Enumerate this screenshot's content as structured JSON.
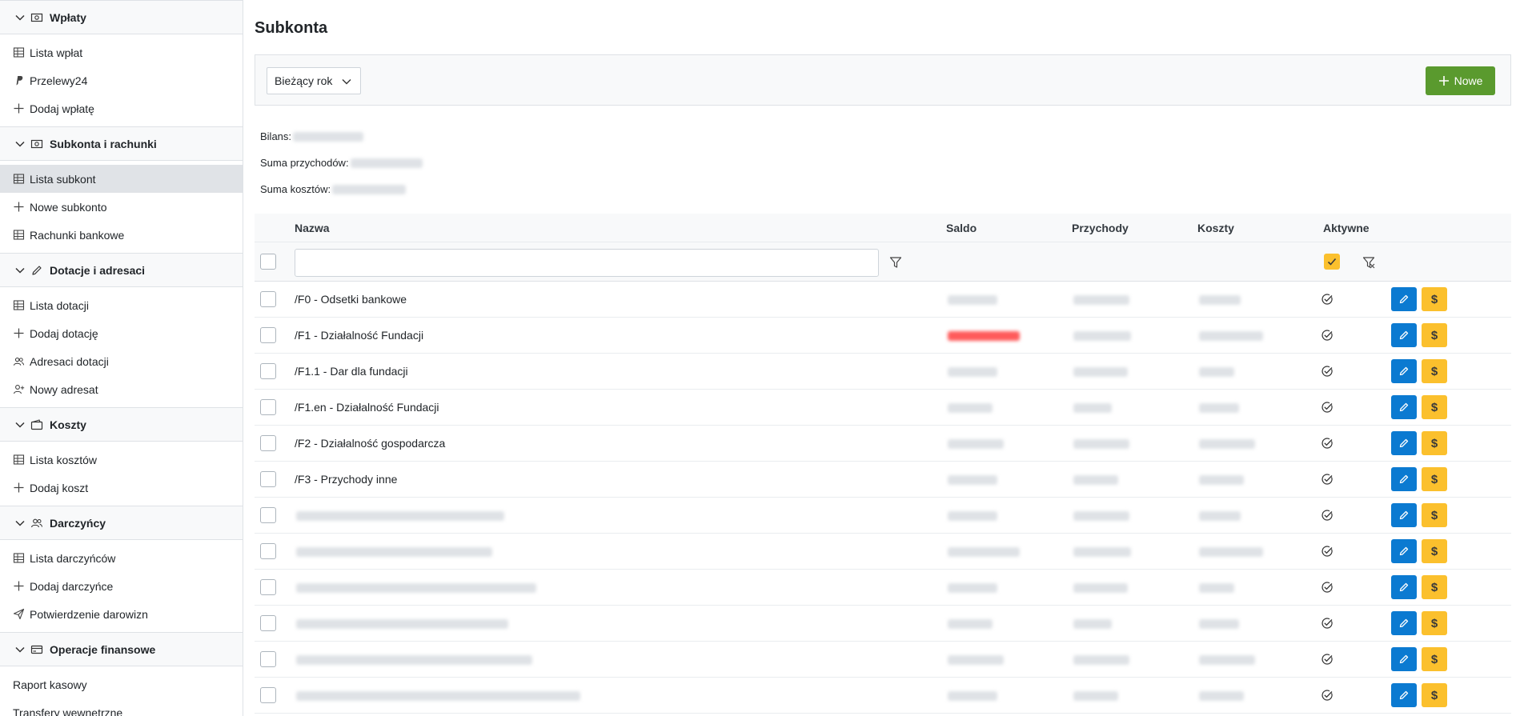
{
  "sidebar": {
    "sections": [
      {
        "title": "Wpłaty",
        "icon": "money-icon",
        "items": [
          {
            "label": "Lista wpłat",
            "icon": "table-icon"
          },
          {
            "label": "Przelewy24",
            "icon": "paypal-icon"
          },
          {
            "label": "Dodaj wpłatę",
            "icon": "plus-icon"
          }
        ]
      },
      {
        "title": "Subkonta i rachunki",
        "icon": "money-icon",
        "items": [
          {
            "label": "Lista subkont",
            "icon": "table-icon",
            "active": true
          },
          {
            "label": "Nowe subkonto",
            "icon": "plus-icon"
          },
          {
            "label": "Rachunki bankowe",
            "icon": "table-icon"
          }
        ]
      },
      {
        "title": "Dotacje i adresaci",
        "icon": "pencil-icon",
        "items": [
          {
            "label": "Lista dotacji",
            "icon": "table-icon"
          },
          {
            "label": "Dodaj dotację",
            "icon": "plus-icon"
          },
          {
            "label": "Adresaci dotacji",
            "icon": "users-icon"
          },
          {
            "label": "Nowy adresat",
            "icon": "user-plus-icon"
          }
        ]
      },
      {
        "title": "Koszty",
        "icon": "wallet-icon",
        "items": [
          {
            "label": "Lista kosztów",
            "icon": "table-icon"
          },
          {
            "label": "Dodaj koszt",
            "icon": "plus-icon"
          }
        ]
      },
      {
        "title": "Darczyńcy",
        "icon": "users-icon",
        "items": [
          {
            "label": "Lista darczyńców",
            "icon": "table-icon"
          },
          {
            "label": "Dodaj darczyńce",
            "icon": "plus-icon"
          },
          {
            "label": "Potwierdzenie darowizn",
            "icon": "send-icon"
          }
        ]
      },
      {
        "title": "Operacje finansowe",
        "icon": "card-icon",
        "items": [
          {
            "label": "Raport kasowy",
            "icon": ""
          },
          {
            "label": "Transfery wewnętrzne",
            "icon": ""
          }
        ]
      }
    ]
  },
  "page": {
    "title": "Subkonta"
  },
  "toolbar": {
    "year_select": "Bieżący rok",
    "new_button": "Nowe"
  },
  "summary": {
    "balance_label": "Bilans:",
    "income_label": "Suma przychodów:",
    "costs_label": "Suma kosztów:"
  },
  "table": {
    "columns": [
      "Nazwa",
      "Saldo",
      "Przychody",
      "Koszty",
      "Aktywne"
    ],
    "rows": [
      {
        "name": "/F0 - Odsetki bankowe"
      },
      {
        "name": "/F1 - Działalność Fundacji",
        "saldo_negative": true
      },
      {
        "name": "/F1.1 - Dar dla fundacji"
      },
      {
        "name": "/F1.en - Działalność Fundacji"
      },
      {
        "name": "/F2 - Działalność gospodarcza"
      },
      {
        "name": "/F3 - Przychody inne"
      },
      {
        "name": ""
      },
      {
        "name": ""
      },
      {
        "name": ""
      },
      {
        "name": ""
      },
      {
        "name": ""
      },
      {
        "name": ""
      }
    ]
  },
  "colors": {
    "primary": "#0b7ad1",
    "warning": "#fbc02d",
    "success": "#5a9a2e",
    "negative": "#ff5b5b"
  }
}
